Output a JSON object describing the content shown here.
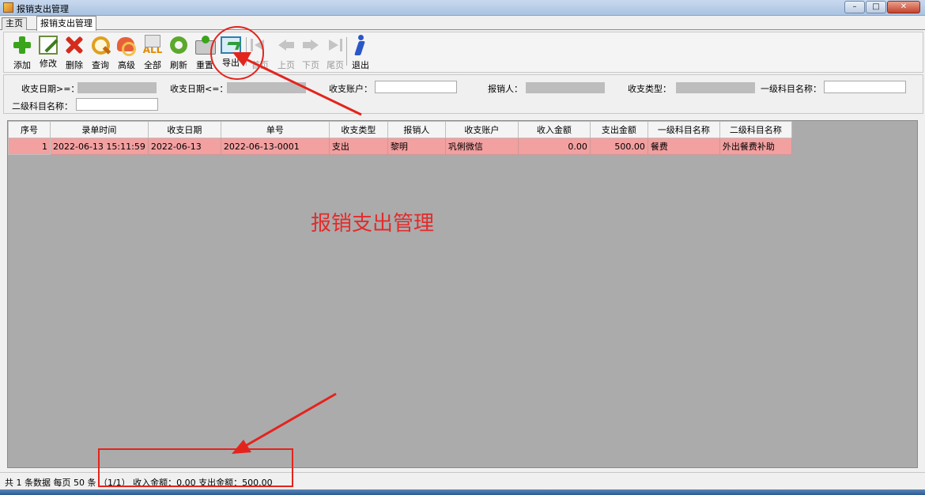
{
  "window": {
    "title": "报销支出管理"
  },
  "tabs": [
    {
      "label": "主页"
    },
    {
      "label": "报销支出管理"
    }
  ],
  "toolbar": {
    "buttons": [
      {
        "label": "添加",
        "icon": "add-icon"
      },
      {
        "label": "修改",
        "icon": "edit-icon"
      },
      {
        "label": "删除",
        "icon": "delete-icon"
      },
      {
        "label": "查询",
        "icon": "search-icon"
      },
      {
        "label": "高级",
        "icon": "advanced-icon"
      },
      {
        "label": "全部",
        "icon": "all-icon"
      },
      {
        "label": "刷新",
        "icon": "refresh-icon"
      },
      {
        "label": "重置",
        "icon": "reset-icon"
      },
      {
        "label": "导出",
        "icon": "export-icon"
      },
      {
        "label": "首页",
        "icon": "first-page-icon"
      },
      {
        "label": "上页",
        "icon": "prev-page-icon"
      },
      {
        "label": "下页",
        "icon": "next-page-icon"
      },
      {
        "label": "尾页",
        "icon": "last-page-icon"
      },
      {
        "label": "退出",
        "icon": "exit-icon"
      }
    ]
  },
  "filters": {
    "date_from_label": "收支日期>=：",
    "date_to_label": "收支日期<=：",
    "account_label": "收支账户：",
    "claimant_label": "报销人：",
    "type_label": "收支类型：",
    "level1_label": "一级科目名称：",
    "level2_label": "二级科目名称："
  },
  "grid": {
    "columns": [
      "序号",
      "录单时间",
      "收支日期",
      "单号",
      "收支类型",
      "报销人",
      "收支账户",
      "收入金额",
      "支出金额",
      "一级科目名称",
      "二级科目名称"
    ],
    "rows": [
      {
        "index": "1",
        "entry_time": "2022-06-13 15:11:59",
        "date": "2022-06-13",
        "number": "2022-06-13-0001",
        "type": "支出",
        "claimant": "黎明",
        "account": "巩俐微信",
        "income": "0.00",
        "expense": "500.00",
        "level1": "餐费",
        "level2": "外出餐费补助"
      }
    ]
  },
  "watermark": "报销支出管理",
  "status": {
    "text": "共 1 条数据  每页 50 条  （1/1）  收入金额：0.00  支出金额：500.00"
  },
  "colors": {
    "accent_red": "#e3241d",
    "selected_row": "#f2a0a0",
    "grid_background": "#ababab"
  }
}
